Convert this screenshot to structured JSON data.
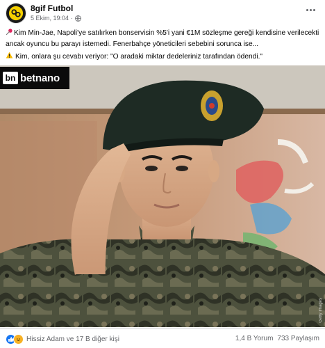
{
  "post": {
    "page_name": "8gif Futbol",
    "date": "5 Ekim, 19:04",
    "dot": "·",
    "more_icon": "more-horizontal-icon",
    "caption_line1": "Kim Min-Jae, Napoli'ye satılırken bonservisin %5'i yani €1M sözleşme gereği kendisine verilecekti ancak oyuncu bu parayı istemedi. Fenerbahçe yöneticileri sebebini sorunca ise...",
    "caption_line2": "Kim, onlara şu cevabı veriyor: \"O aradaki miktar dedeleriniz tarafından ödendi.\"",
    "caption_line1_icon": "pushpin-icon",
    "caption_line2_icon": "warning-icon"
  },
  "image": {
    "brand_logo": "bn",
    "brand_name": "betnano",
    "credit": "Getty Images"
  },
  "footer": {
    "reactions_text": "Hissiz Adam ve 17 B diğer kişi",
    "comments": "1,4 B Yorum",
    "shares": "733 Paylaşım"
  },
  "colors": {
    "accent": "#1877f2",
    "secondary_text": "#65676b",
    "haha": "#f7b125",
    "brand_bg": "#0b0b0b"
  }
}
